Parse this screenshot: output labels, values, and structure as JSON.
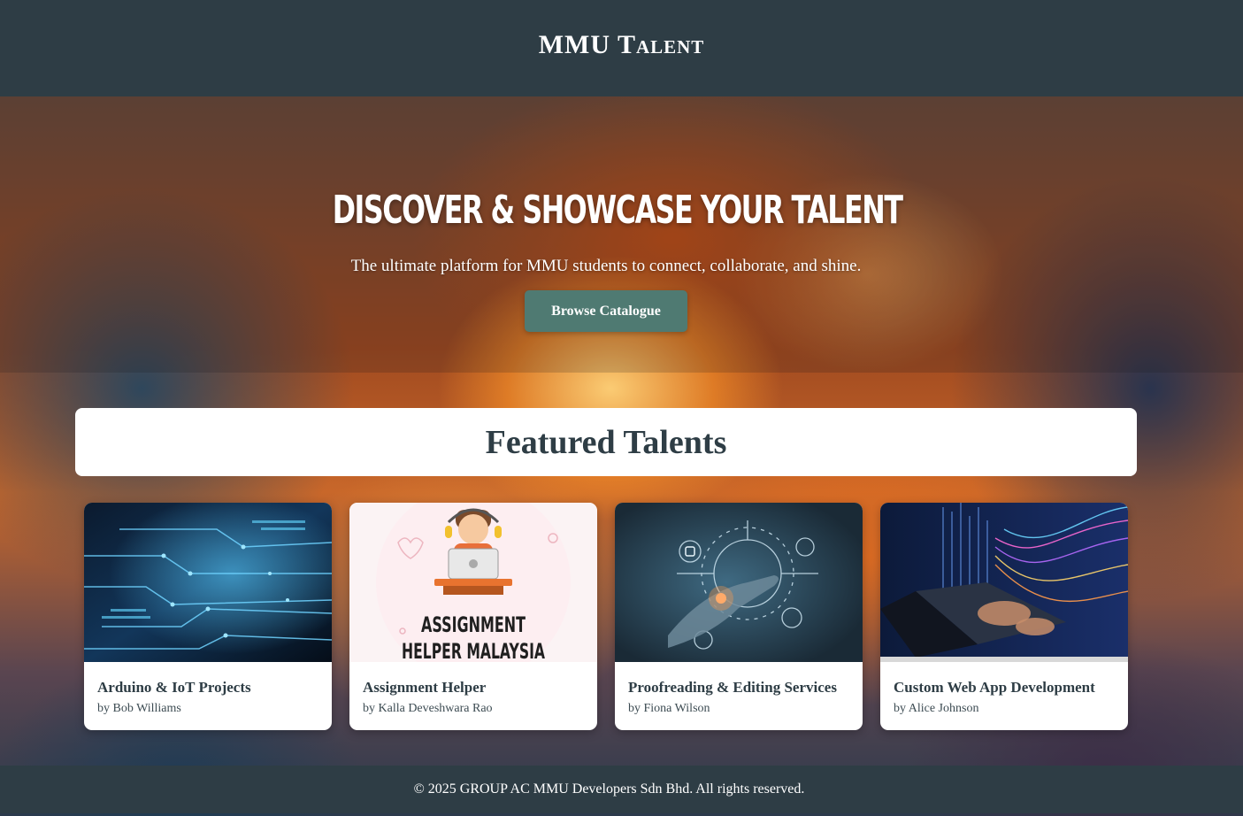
{
  "header": {
    "brand": "MMU Talent"
  },
  "hero": {
    "title": "Discover & Showcase Your Talent",
    "subtitle": "The ultimate platform for MMU students to connect, collaborate, and shine.",
    "cta_label": "Browse Catalogue"
  },
  "featured": {
    "heading": "Featured Talents",
    "cards": [
      {
        "title": "Arduino & IoT Projects",
        "author": "by Bob Williams",
        "image": "circuit-board-image"
      },
      {
        "title": "Assignment Helper",
        "author": "by Kalla Deveshwara Rao",
        "image": "assignment-helper-image",
        "image_text": [
          "ASSIGNMENT",
          "HELPER MALAYSIA"
        ]
      },
      {
        "title": "Proofreading & Editing Services",
        "author": "by Fiona Wilson",
        "image": "digital-hand-image"
      },
      {
        "title": "Custom Web App Development",
        "author": "by Alice Johnson",
        "image": "laptop-code-image"
      }
    ]
  },
  "footer": {
    "copyright": "© 2025 GROUP AC MMU Developers Sdn Bhd. All rights reserved."
  },
  "colors": {
    "header_bg": "#2e3d45",
    "button_bg": "#4f7a72",
    "heading_text": "#2e3d45",
    "card_bg": "#ffffff"
  }
}
